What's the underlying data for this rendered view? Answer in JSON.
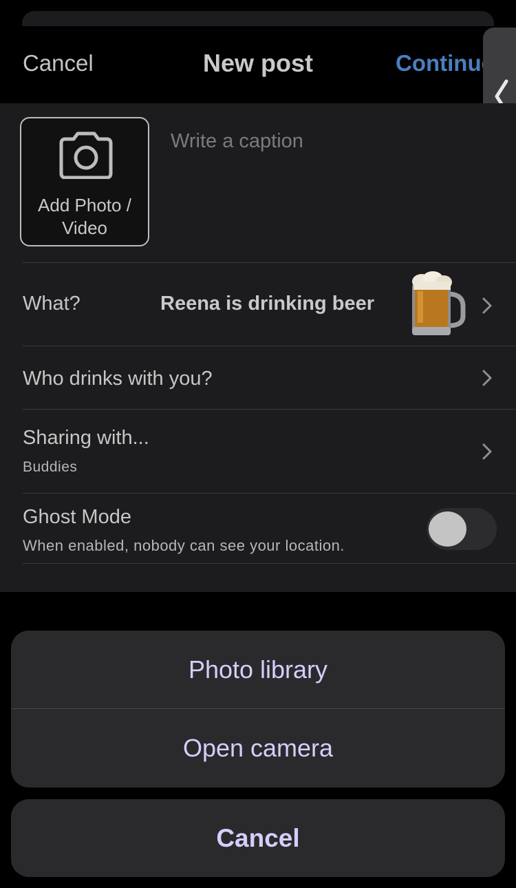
{
  "nav": {
    "cancel_label": "Cancel",
    "title": "New post",
    "continue_label": "Continue"
  },
  "composer": {
    "add_media_label_line1": "Add Photo /",
    "add_media_label_line2": "Video",
    "caption_placeholder": "Write a caption",
    "caption_value": ""
  },
  "rows": {
    "what": {
      "label": "What?",
      "value": "Reena is drinking beer",
      "icon": "beer-mug-icon"
    },
    "who": {
      "label": "Who drinks with you?"
    },
    "sharing": {
      "label": "Sharing with...",
      "value": "Buddies"
    },
    "ghost": {
      "label": "Ghost Mode",
      "description": "When enabled, nobody can see your location.",
      "enabled": false
    }
  },
  "action_sheet": {
    "photo_library_label": "Photo library",
    "open_camera_label": "Open camera",
    "cancel_label": "Cancel"
  },
  "colors": {
    "accent_blue": "#4a7fc1",
    "action_text": "#d7cdfc",
    "sheet_background": "#1c1c1e"
  }
}
